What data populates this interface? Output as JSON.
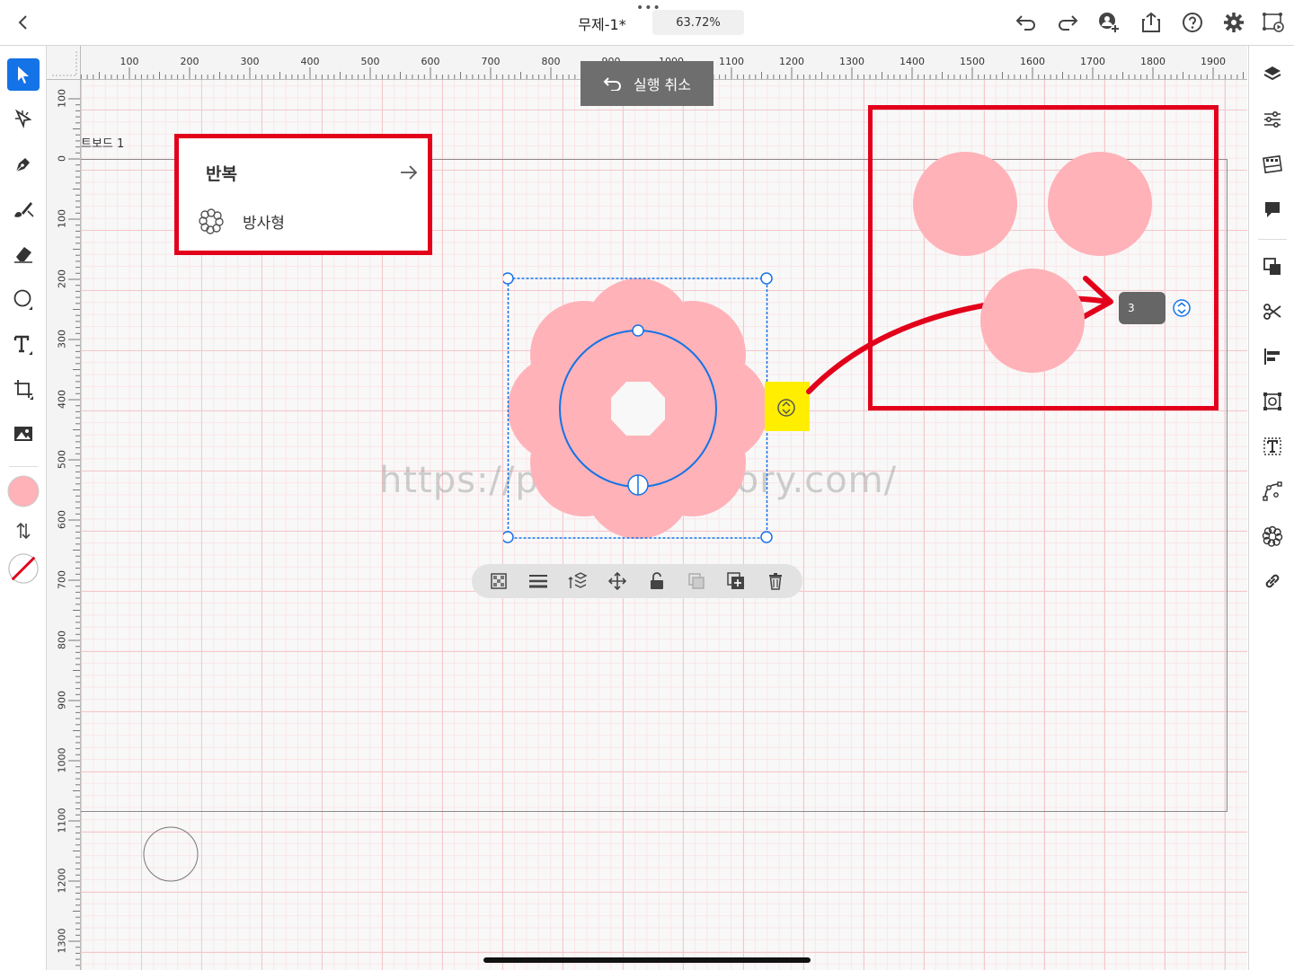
{
  "topbar": {
    "title": "무제-1*",
    "zoom": "63.72%"
  },
  "rulers": {
    "h_ticks": [
      "100",
      "200",
      "300",
      "400",
      "500",
      "600",
      "700",
      "800",
      "900",
      "1000",
      "1100",
      "1200",
      "1300",
      "1400",
      "1500",
      "1600",
      "1700",
      "1800",
      "1900"
    ],
    "v_ticks": [
      "100",
      "0",
      "100",
      "200",
      "300",
      "400",
      "500",
      "600",
      "700",
      "800",
      "900",
      "1000",
      "1100",
      "1200",
      "1300"
    ]
  },
  "artboard": {
    "label": "트보드 1"
  },
  "undo_toast": {
    "label": "실행 취소"
  },
  "repeat_panel": {
    "title": "반복",
    "option_label": "방사형"
  },
  "preview": {
    "count_value": "3"
  },
  "watermark": "https://pikeo77.tistory.com/",
  "colors": {
    "fill": "#ffb2b8",
    "accent": "#1473e6",
    "callout": "#e2001a",
    "highlight": "#ffee00",
    "toast": "#6e6e6e"
  },
  "icons": {
    "top": [
      "back-icon",
      "undo-icon",
      "redo-icon",
      "invite-icon",
      "share-icon",
      "help-icon",
      "settings-icon",
      "artboard-preview-icon"
    ],
    "left": [
      "select-icon",
      "direct-select-icon",
      "pen-icon",
      "brush-icon",
      "eraser-icon",
      "ellipse-icon",
      "text-icon",
      "crop-icon",
      "image-icon"
    ],
    "right": [
      "layers-icon",
      "properties-icon",
      "swatches-icon",
      "comments-icon",
      "pathfinder-icon",
      "scissors-icon",
      "align-icon",
      "transform-icon",
      "type-icon",
      "curvature-icon",
      "repeat-icon",
      "link-icon"
    ],
    "selection": [
      "opacity-icon",
      "stroke-icon",
      "arrange-icon",
      "move-icon",
      "lock-icon",
      "duplicate-disabled-icon",
      "add-copy-icon",
      "delete-icon"
    ]
  }
}
